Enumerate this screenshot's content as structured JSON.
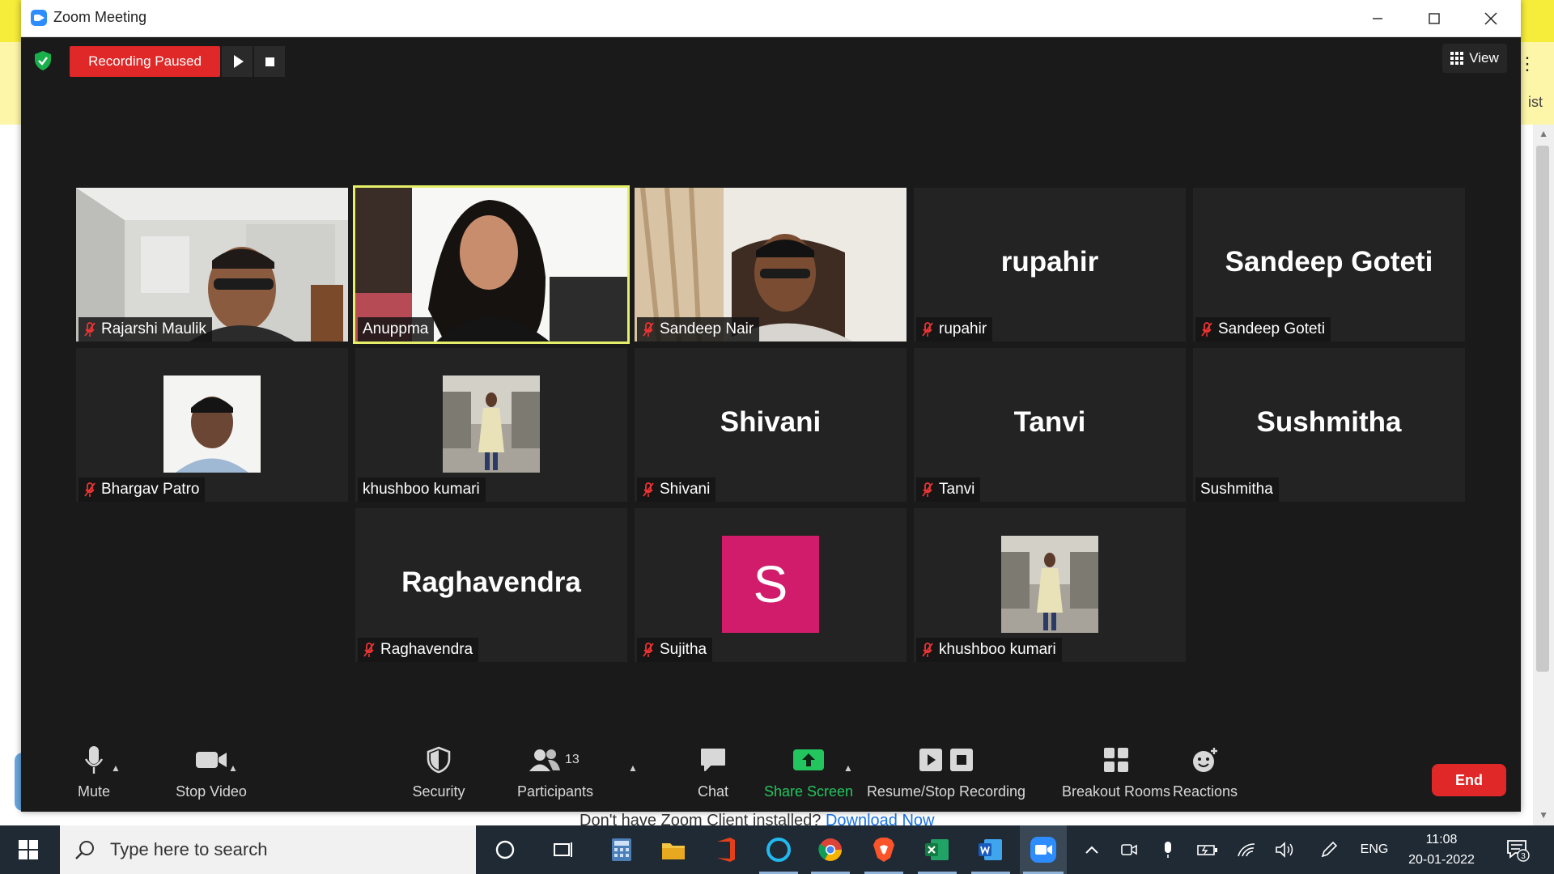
{
  "background": {
    "list_fragment": "ist",
    "footer_text": "Don't have Zoom Client installed?",
    "footer_link": "Download Now"
  },
  "window": {
    "title": "Zoom Meeting",
    "controls": {
      "minimize": "–",
      "maximize": "☐",
      "close": "✕"
    }
  },
  "recording": {
    "status": "Recording Paused",
    "resume_icon": "play-icon",
    "stop_icon": "stop-icon"
  },
  "view_button": {
    "label": "View",
    "icon": "grid-icon"
  },
  "participants": [
    {
      "name": "Rajarshi Maulik",
      "muted": true,
      "display": "video"
    },
    {
      "name": "Anuppma",
      "muted": false,
      "display": "video",
      "active_speaker": true
    },
    {
      "name": "Sandeep Nair",
      "muted": true,
      "display": "video"
    },
    {
      "name": "rupahir",
      "muted": true,
      "display": "name",
      "big_name": "rupahir"
    },
    {
      "name": "Sandeep Goteti",
      "muted": true,
      "display": "name",
      "big_name": "Sandeep Goteti"
    },
    {
      "name": "Bhargav Patro",
      "muted": true,
      "display": "photo"
    },
    {
      "name": "khushboo kumari",
      "muted": false,
      "display": "photo"
    },
    {
      "name": "Shivani",
      "muted": true,
      "display": "name",
      "big_name": "Shivani"
    },
    {
      "name": "Tanvi",
      "muted": true,
      "display": "name",
      "big_name": "Tanvi"
    },
    {
      "name": "Sushmitha",
      "muted": false,
      "display": "name",
      "big_name": "Sushmitha"
    },
    {
      "name": "Raghavendra",
      "muted": true,
      "display": "name",
      "big_name": "Raghavendra"
    },
    {
      "name": "Sujitha",
      "muted": true,
      "display": "avatar",
      "avatar_letter": "S",
      "avatar_color": "#d01c6b"
    },
    {
      "name": "khushboo kumari",
      "muted": true,
      "display": "photo"
    }
  ],
  "toolbar": {
    "mute": "Mute",
    "stop_video": "Stop Video",
    "security": "Security",
    "participants": "Participants",
    "participants_count": "13",
    "chat": "Chat",
    "share_screen": "Share Screen",
    "recording": "Resume/Stop Recording",
    "breakout": "Breakout Rooms",
    "reactions": "Reactions",
    "end": "End"
  },
  "taskbar": {
    "search_placeholder": "Type here to search",
    "language": "ENG",
    "time": "11:08",
    "date": "20-01-2022",
    "notifications": "3"
  },
  "colors": {
    "end_red": "#e02828",
    "share_green": "#22c55e",
    "active_border": "#e6ef6a",
    "meeting_bg": "#1a1a1a"
  }
}
